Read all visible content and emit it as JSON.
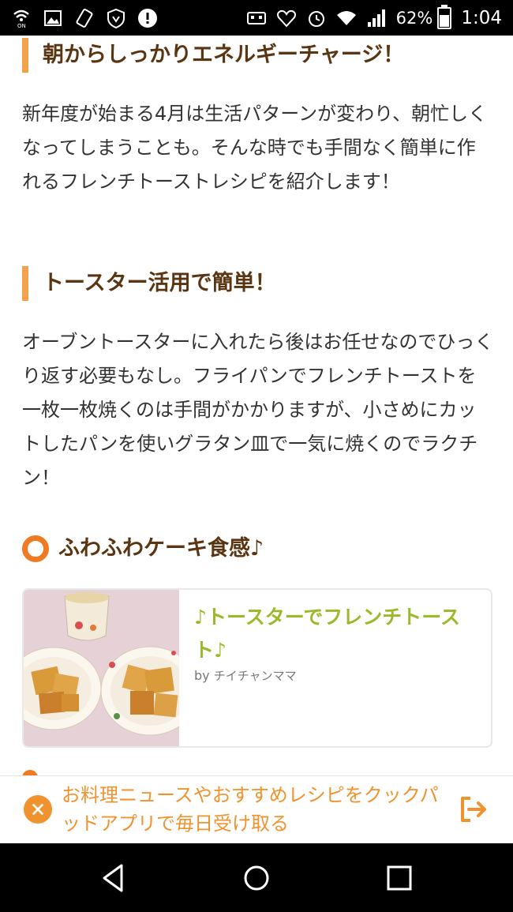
{
  "status_bar": {
    "battery_percent": "62%",
    "time": "1:04",
    "left_icons": [
      "wifi-calling-icon",
      "image-icon",
      "rotate-icon",
      "shield-icon",
      "alert-icon"
    ],
    "right_icons": [
      "robot-icon",
      "heart-icon",
      "alarm-icon",
      "wifi-icon",
      "signal-icon",
      "battery-icon"
    ]
  },
  "article": {
    "heading1": "朝からしっかりエネルギーチャージ！",
    "para1": "新年度が始まる4月は生活パターンが変わり、朝忙しくなってしまうことも。そんな時でも手間なく簡単に作れるフレンチトーストレシピを紹介します！",
    "heading2": "トースター活用で簡単！",
    "para2": "オーブントースターに入れたら後はお任せなのでひっくり返す必要もなし。フライパンでフレンチトーストを一枚一枚焼くのは手間がかかりますが、小さめにカットしたパンを使いグラタン皿で一気に焼くのでラクチン！",
    "subheading": "ふわふわケーキ食感♪"
  },
  "recipe_card": {
    "title": "♪トースターでフレンチトースト♪",
    "by_label": "by",
    "author": "チイチャンママ"
  },
  "banner": {
    "text": "お料理ニュースやおすすめレシピをクックパッドアプリで毎日受け取る"
  },
  "colors": {
    "accent_orange": "#f07a22",
    "heading_brown": "#5a3512",
    "card_title_green": "#9aba2b",
    "banner_orange": "#f0922e"
  }
}
